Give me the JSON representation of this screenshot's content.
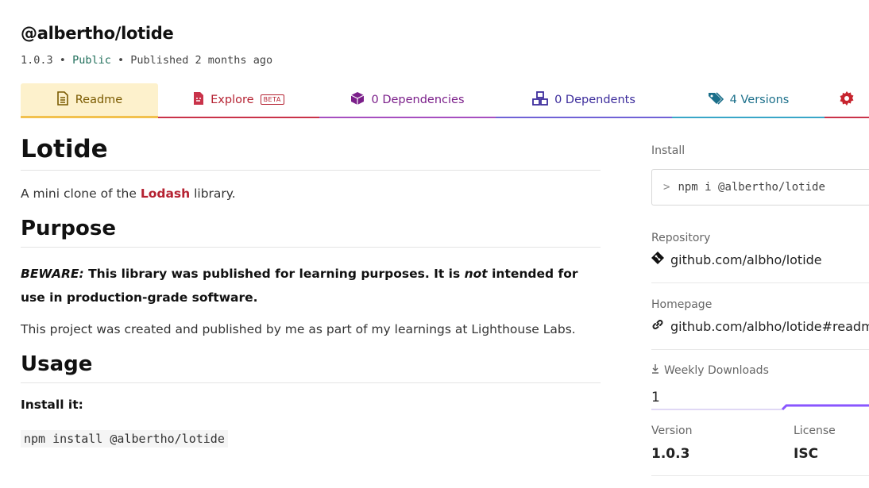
{
  "header": {
    "title": "@albertho/lotide",
    "version": "1.0.3",
    "sep1": "•",
    "visibility": "Public",
    "sep2": "•",
    "published": "Published 2 months ago"
  },
  "tabs": {
    "readme": "Readme",
    "explore": "Explore",
    "explore_badge": "BETA",
    "dependencies": "0 Dependencies",
    "dependents": "0 Dependents",
    "versions": "4 Versions"
  },
  "readme": {
    "h1": "Lotide",
    "intro_before": "A mini clone of the ",
    "intro_link": "Lodash",
    "intro_after": " library.",
    "purpose_heading": "Purpose",
    "beware_label": "BEWARE:",
    "beware_text_1": " This library was published for learning purposes. It is ",
    "beware_not": "not",
    "beware_text_2": " intended for use in production-grade software.",
    "project_text": "This project was created and published by me as part of my learnings at Lighthouse Labs.",
    "usage_heading": "Usage",
    "install_label": "Install it:",
    "install_code": "npm install @albertho/lotide"
  },
  "sidebar": {
    "install_label": "Install",
    "install_prompt": ">",
    "install_command": "npm i @albertho/lotide",
    "repository_label": "Repository",
    "repository_value": "github.com/albho/lotide",
    "homepage_label": "Homepage",
    "homepage_value": "github.com/albho/lotide#readme",
    "downloads_label": "Weekly Downloads",
    "downloads_value": "1",
    "version_label": "Version",
    "version_value": "1.0.3",
    "license_label": "License",
    "license_value": "ISC"
  },
  "colors": {
    "readme_tab": "#fdf1cc",
    "explore": "#b52232",
    "dependencies": "#7b1f8a",
    "dependents": "#3c2c9c",
    "versions": "#1b6f8a",
    "sparkline": "#8956ff"
  }
}
